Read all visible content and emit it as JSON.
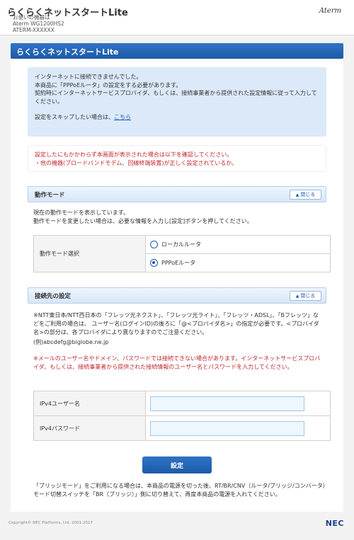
{
  "header": {
    "app_title": "らくらくネットスタートLite",
    "device_caption": "お使いの機器は",
    "device_model": "Aterm WG1200HS2",
    "device_id": "ATERM-XXXXXX",
    "brand": "Aterm"
  },
  "titlebar": {
    "title": "らくらくネットスタートLite"
  },
  "info": {
    "line1": "インターネットに接続できませんでした。",
    "line2": "本商品に「PPPoEルータ」の設定をする必要があります。",
    "line3": "契約時にインターネットサービスプロバイダ、もしくは、接続事業者から提供された設定情報に従って入力してください。",
    "skip_text": "設定をスキップしたい場合は、",
    "skip_link": "こちら"
  },
  "warning": {
    "line1": "設定したにもかかわらず本画面が表示された場合は以下を確認してください。",
    "line2": "・他の機器(ブロードバンドモデム、回線終端装置)が正しく設定されているか。"
  },
  "mode_section": {
    "title": "動作モード",
    "collapse_label": "閉じる",
    "desc1": "現在の動作モードを表示しています。",
    "desc2": "動作モードを変更したい場合は、必要な情報を入力し[設定]ボタンを押してください。",
    "field_label": "動作モード選択",
    "options": [
      "ローカルルータ",
      "PPPoEルータ"
    ],
    "selected": "PPPoEルータ"
  },
  "connection_section": {
    "title": "接続先の設定",
    "collapse_label": "閉じる",
    "note1": "※NTT東日本/NTT西日本の「フレッツ光ネクスト」、「フレッツ光ライト」、「フレッツ・ADSL」、「Bフレッツ」などをご利用の場合は、 ユーザー名(ログインID)の後ろに「@<プロバイダ名>」の指定が必要です。<プロバイダ名>の部分は、各プロバイダにより異なりますのでご注意ください。",
    "example": "(例)abcdefg@biglobe.ne.jp",
    "note2": "※メールのユーザー名やドメイン、パスワードでは接続できない場合があります。インターネットサービスプロバイダ、もしくは、接続事業者から提供された接続情報のユーザー名とパスワードを入力してください。",
    "username_label": "IPv4ユーザー名",
    "username_value": "",
    "password_label": "IPv4パスワード",
    "password_value": ""
  },
  "submit_label": "設定",
  "footer_note": "「ブリッジモード」をご利用になる場合は、本商品の電源を切った後、RT/BR/CNV（ルータ/ブリッジ/コンバータ）モード切替スイッチを「BR（ブリッジ）」側に切り替えて、再度本商品の電源を入れてください。",
  "copyright": "Copyright© NEC Platforms, Ltd. 2001-2017",
  "footer_brand": "NEC",
  "colors": {
    "accent": "#1d5aa8",
    "warning": "#c0272d",
    "info_bg": "#dbe9f8"
  }
}
